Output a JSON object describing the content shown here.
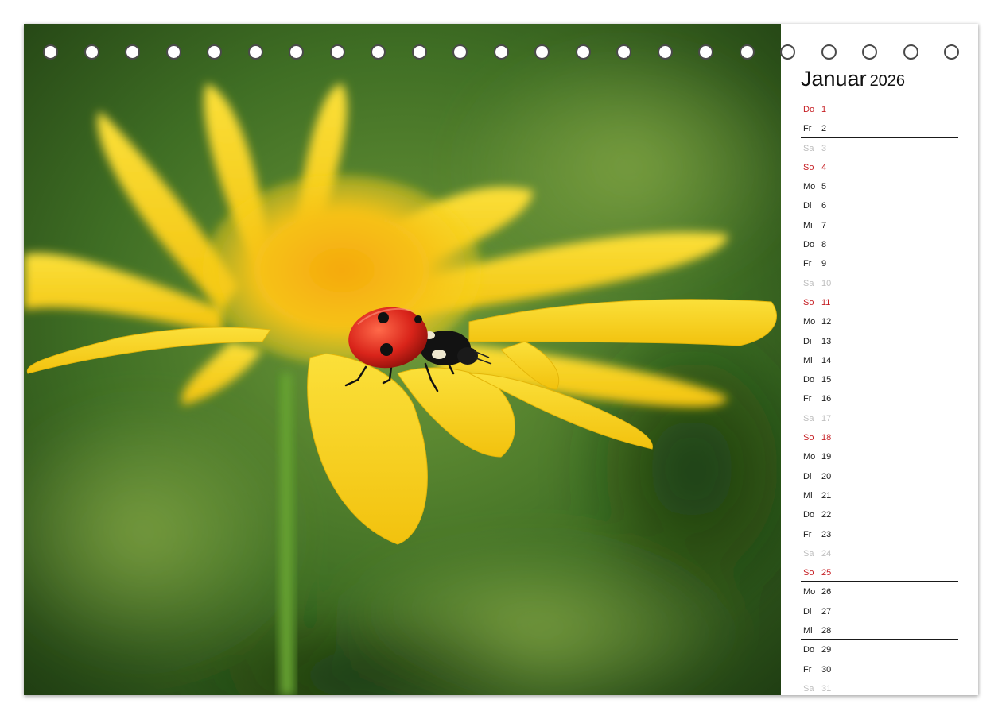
{
  "month": {
    "name": "Januar",
    "year": "2026"
  },
  "days": [
    {
      "wd": "Do",
      "d": "1",
      "type": "holiday"
    },
    {
      "wd": "Fr",
      "d": "2",
      "type": "weekday"
    },
    {
      "wd": "Sa",
      "d": "3",
      "type": "saturday"
    },
    {
      "wd": "So",
      "d": "4",
      "type": "sunday"
    },
    {
      "wd": "Mo",
      "d": "5",
      "type": "weekday"
    },
    {
      "wd": "Di",
      "d": "6",
      "type": "weekday"
    },
    {
      "wd": "Mi",
      "d": "7",
      "type": "weekday"
    },
    {
      "wd": "Do",
      "d": "8",
      "type": "weekday"
    },
    {
      "wd": "Fr",
      "d": "9",
      "type": "weekday"
    },
    {
      "wd": "Sa",
      "d": "10",
      "type": "saturday"
    },
    {
      "wd": "So",
      "d": "11",
      "type": "sunday"
    },
    {
      "wd": "Mo",
      "d": "12",
      "type": "weekday"
    },
    {
      "wd": "Di",
      "d": "13",
      "type": "weekday"
    },
    {
      "wd": "Mi",
      "d": "14",
      "type": "weekday"
    },
    {
      "wd": "Do",
      "d": "15",
      "type": "weekday"
    },
    {
      "wd": "Fr",
      "d": "16",
      "type": "weekday"
    },
    {
      "wd": "Sa",
      "d": "17",
      "type": "saturday"
    },
    {
      "wd": "So",
      "d": "18",
      "type": "sunday"
    },
    {
      "wd": "Mo",
      "d": "19",
      "type": "weekday"
    },
    {
      "wd": "Di",
      "d": "20",
      "type": "weekday"
    },
    {
      "wd": "Mi",
      "d": "21",
      "type": "weekday"
    },
    {
      "wd": "Do",
      "d": "22",
      "type": "weekday"
    },
    {
      "wd": "Fr",
      "d": "23",
      "type": "weekday"
    },
    {
      "wd": "Sa",
      "d": "24",
      "type": "saturday"
    },
    {
      "wd": "So",
      "d": "25",
      "type": "sunday"
    },
    {
      "wd": "Mo",
      "d": "26",
      "type": "weekday"
    },
    {
      "wd": "Di",
      "d": "27",
      "type": "weekday"
    },
    {
      "wd": "Mi",
      "d": "28",
      "type": "weekday"
    },
    {
      "wd": "Do",
      "d": "29",
      "type": "weekday"
    },
    {
      "wd": "Fr",
      "d": "30",
      "type": "weekday"
    },
    {
      "wd": "Sa",
      "d": "31",
      "type": "saturday"
    }
  ],
  "colors": {
    "sunday_holiday": "#c61f24",
    "saturday": "#bfbfbf",
    "weekday": "#1a1a1a",
    "petal": "#f7d21a",
    "ladybug": "#d9241a",
    "background_green": "#4f7d2c"
  },
  "photo": {
    "subject": "ladybug on yellow flower"
  }
}
